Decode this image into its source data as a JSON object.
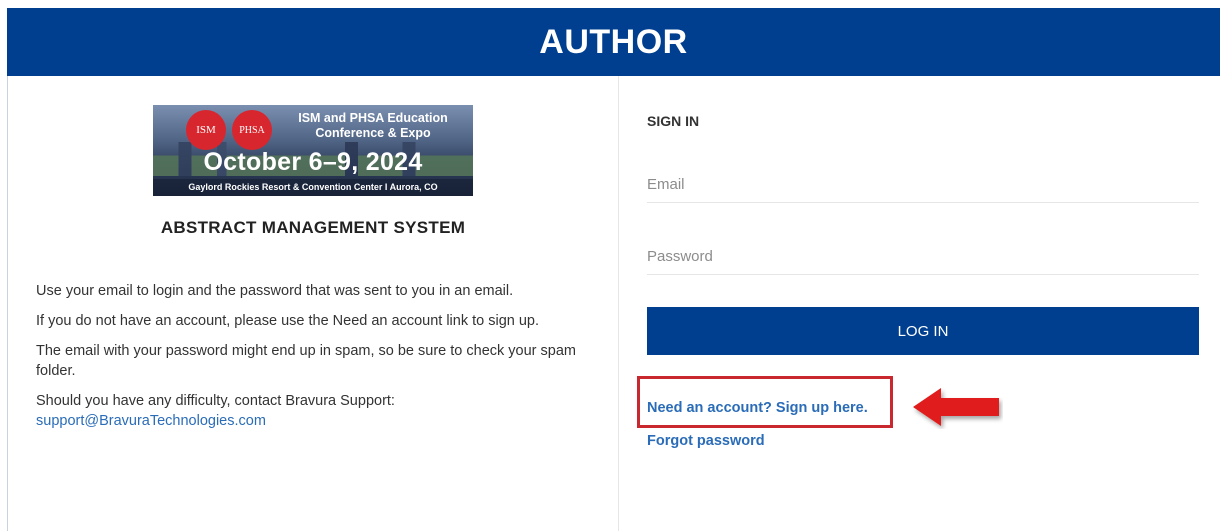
{
  "header": {
    "title": "AUTHOR"
  },
  "banner": {
    "logo_left": "ISM",
    "logo_right": "PHSA",
    "event_line1": "ISM and PHSA Education",
    "event_line2": "Conference & Expo",
    "dates": "October 6–9, 2024",
    "venue": "Gaylord Rockies Resort & Convention Center  I  Aurora, CO"
  },
  "left": {
    "system_title": "ABSTRACT MANAGEMENT SYSTEM",
    "paragraphs": [
      "Use your email to login and the password that was sent to you in an email.",
      "If you do not have an account, please use the Need an account link to sign up.",
      "The email with your password might end up in spam, so be sure to check your spam folder.",
      "Should you have any difficulty, contact Bravura Support:"
    ],
    "support_email": "support@BravuraTechnologies.com"
  },
  "signin": {
    "heading": "SIGN IN",
    "email_placeholder": "Email",
    "email_value": "",
    "password_placeholder": "Password",
    "password_value": "",
    "login_label": "LOG IN",
    "signup_link": "Need an account? Sign up here.",
    "forgot_link": "Forgot password"
  },
  "colors": {
    "brand_blue": "#003f8f",
    "link_blue": "#2a6cb8",
    "highlight_red": "#c8282e",
    "arrow_red": "#e01e1e"
  },
  "icons": {
    "annotation_arrow": "left-arrow-icon"
  }
}
